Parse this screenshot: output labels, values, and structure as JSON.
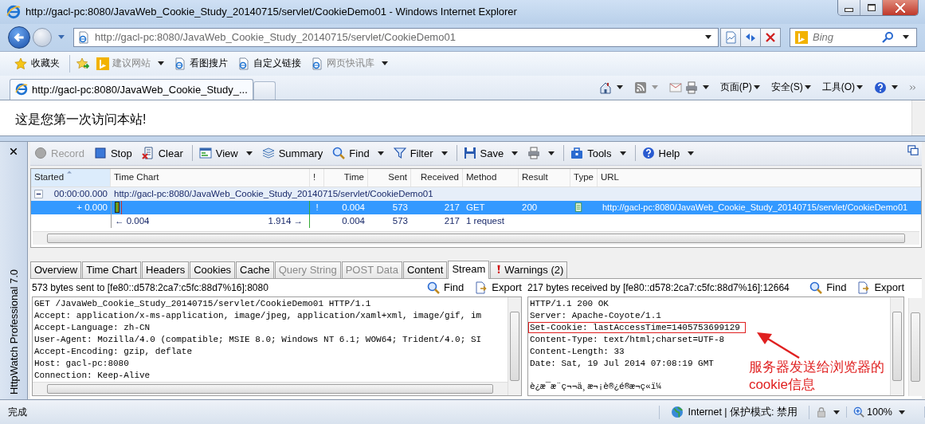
{
  "window": {
    "title": "http://gacl-pc:8080/JavaWeb_Cookie_Study_20140715/servlet/CookieDemo01 - Windows Internet Explorer"
  },
  "address_bar": {
    "url": "http://gacl-pc:8080/JavaWeb_Cookie_Study_20140715/servlet/CookieDemo01"
  },
  "search": {
    "placeholder": "Bing"
  },
  "favorites_bar": {
    "favorites_button": "收藏夹",
    "links": [
      {
        "label": "建议网站",
        "dropdown": true
      },
      {
        "label": "看图搜片",
        "dropdown": false
      },
      {
        "label": "自定义链接",
        "dropdown": false
      },
      {
        "label": "网页快讯库",
        "dropdown": true
      }
    ]
  },
  "tabs": [
    {
      "label": "http://gacl-pc:8080/JavaWeb_Cookie_Study_...",
      "selected": true
    }
  ],
  "command_bar": {
    "menus": [
      "页面(P)",
      "安全(S)",
      "工具(O)"
    ]
  },
  "page": {
    "text": "这是您第一次访问本站!"
  },
  "httpwatch": {
    "title": "HttpWatch Professional 7.0",
    "toolbar": [
      {
        "kind": "record",
        "label": "Record",
        "disabled": true,
        "dropdown": false,
        "separator_before": false
      },
      {
        "kind": "stop",
        "label": "Stop",
        "disabled": false,
        "dropdown": false,
        "separator_before": false
      },
      {
        "kind": "clear",
        "label": "Clear",
        "disabled": false,
        "dropdown": false,
        "separator_before": false
      },
      {
        "kind": "view",
        "label": "View",
        "disabled": false,
        "dropdown": true,
        "separator_before": true
      },
      {
        "kind": "summary",
        "label": "Summary",
        "disabled": false,
        "dropdown": false,
        "separator_before": false
      },
      {
        "kind": "find",
        "label": "Find",
        "disabled": false,
        "dropdown": true,
        "separator_before": false
      },
      {
        "kind": "filter",
        "label": "Filter",
        "disabled": false,
        "dropdown": true,
        "separator_before": false
      },
      {
        "kind": "save",
        "label": "Save",
        "disabled": false,
        "dropdown": true,
        "separator_before": true
      },
      {
        "kind": "print",
        "disabled": false,
        "dropdown": true,
        "separator_before": false
      },
      {
        "kind": "tools",
        "label": "Tools",
        "disabled": false,
        "dropdown": true,
        "separator_before": true
      },
      {
        "kind": "help",
        "label": "Help",
        "disabled": false,
        "dropdown": true,
        "separator_before": true
      }
    ],
    "columns": [
      {
        "label": "Started",
        "sorted": true
      },
      {
        "label": "Time Chart",
        "sorted": false
      },
      {
        "label": "!",
        "sorted": false
      },
      {
        "label": "Time",
        "sorted": false
      },
      {
        "label": "Sent",
        "sorted": false
      },
      {
        "label": "Received",
        "sorted": false
      },
      {
        "label": "Method",
        "sorted": false
      },
      {
        "label": "Result",
        "sorted": false
      },
      {
        "label": "Type",
        "sorted": false
      },
      {
        "label": "URL",
        "sorted": false
      }
    ],
    "group": {
      "expanded": true,
      "started": "00:00:00.000",
      "url": "http://gacl-pc:8080/JavaWeb_Cookie_Study_20140715/servlet/CookieDemo01"
    },
    "rows": [
      {
        "kind": "request",
        "selected": true,
        "started": "+ 0.000",
        "warning": "!",
        "time": "0.004",
        "sent": "573",
        "received": "217",
        "method": "GET",
        "result": "200",
        "url": "http://gacl-pc:8080/JavaWeb_Cookie_Study_20140715/servlet/CookieDemo01"
      },
      {
        "kind": "summary",
        "selected": false,
        "chart_start": "← 0.004",
        "chart_end": "1.914 →",
        "time": "0.004",
        "sent": "573",
        "received": "217",
        "method": "1 request"
      }
    ],
    "detail_tabs": [
      {
        "label": "Overview",
        "selected": false,
        "disabled": false,
        "warning": false
      },
      {
        "label": "Time Chart",
        "selected": false,
        "disabled": false,
        "warning": false
      },
      {
        "label": "Headers",
        "selected": false,
        "disabled": false,
        "warning": false
      },
      {
        "label": "Cookies",
        "selected": false,
        "disabled": false,
        "warning": false
      },
      {
        "label": "Cache",
        "selected": false,
        "disabled": false,
        "warning": false
      },
      {
        "label": "Query String",
        "selected": false,
        "disabled": true,
        "warning": false
      },
      {
        "label": "POST Data",
        "selected": false,
        "disabled": true,
        "warning": false
      },
      {
        "label": "Content",
        "selected": false,
        "disabled": false,
        "warning": false
      },
      {
        "label": "Stream",
        "selected": true,
        "disabled": false,
        "warning": false
      },
      {
        "label": "Warnings (2)",
        "selected": false,
        "disabled": false,
        "warning": true
      }
    ],
    "panes": [
      {
        "summary": "573 bytes sent to [fe80::d578:2ca7:c5fc:88d7%16]:8080",
        "actions": [
          "Find",
          "Export"
        ],
        "horizontal_scroll": true,
        "lines": [
          {
            "text": "GET /JavaWeb_Cookie_Study_20140715/servlet/CookieDemo01 HTTP/1.1",
            "highlighted": false
          },
          {
            "text": "Accept: application/x-ms-application, image/jpeg, application/xaml+xml, image/gif, im",
            "highlighted": false
          },
          {
            "text": "Accept-Language: zh-CN",
            "highlighted": false
          },
          {
            "text": "User-Agent: Mozilla/4.0 (compatible; MSIE 8.0; Windows NT 6.1; WOW64; Trident/4.0; SI",
            "highlighted": false
          },
          {
            "text": "Accept-Encoding: gzip, deflate",
            "highlighted": false
          },
          {
            "text": "Host: gacl-pc:8080",
            "highlighted": false
          },
          {
            "text": "Connection: Keep-Alive",
            "highlighted": false
          }
        ]
      },
      {
        "summary": "217 bytes received by [fe80::d578:2ca7:c5fc:88d7%16]:12664",
        "actions": [
          "Find",
          "Export"
        ],
        "horizontal_scroll": false,
        "lines": [
          {
            "text": "HTTP/1.1 200 OK",
            "highlighted": false
          },
          {
            "text": "Server: Apache-Coyote/1.1",
            "highlighted": false
          },
          {
            "text": "Set-Cookie: lastAccessTime=1405753699129",
            "highlighted": true
          },
          {
            "text": "Content-Type: text/html;charset=UTF-8",
            "highlighted": false
          },
          {
            "text": "Content-Length: 33",
            "highlighted": false
          },
          {
            "text": "Date: Sat, 19 Jul 2014 07:08:19 GMT",
            "highlighted": false
          },
          {
            "text": "è¿æ¯æ¨ç¬¬ä¸æ¬¡è®¿é®æ¬ç«ï¼",
            "highlighted": false,
            "blank_before": true
          }
        ]
      }
    ]
  },
  "annotation": {
    "lines": [
      "服务器发送给浏览器的",
      "cookie信息"
    ]
  },
  "status_bar": {
    "text": "完成",
    "zone": "Internet | 保护模式: 禁用",
    "zoom": "100%"
  }
}
